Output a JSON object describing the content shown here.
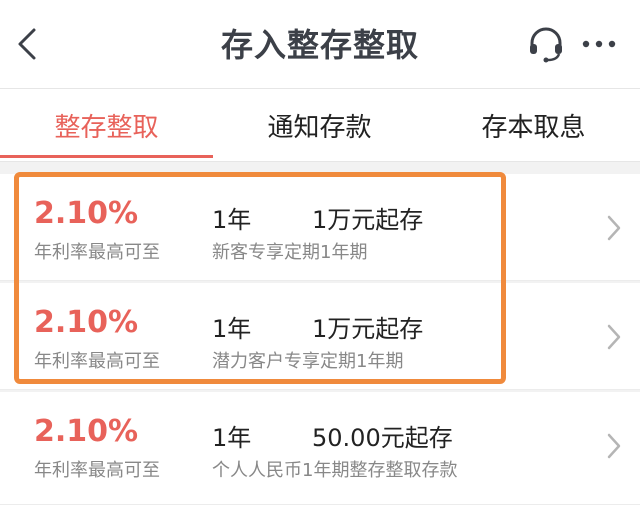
{
  "header": {
    "title": "存入整存整取"
  },
  "tabs": [
    {
      "label": "整存整取",
      "active": true
    },
    {
      "label": "通知存款",
      "active": false
    },
    {
      "label": "存本取息",
      "active": false
    }
  ],
  "products": [
    {
      "rate": "2.10%",
      "rate_label": "年利率最高可至",
      "term": "1年",
      "min_amount": "1万元起存",
      "desc": "新客专享定期1年期"
    },
    {
      "rate": "2.10%",
      "rate_label": "年利率最高可至",
      "term": "1年",
      "min_amount": "1万元起存",
      "desc": "潜力客户专享定期1年期"
    },
    {
      "rate": "2.10%",
      "rate_label": "年利率最高可至",
      "term": "1年",
      "min_amount": "50.00元起存",
      "desc": "个人人民币1年期整存整取存款"
    }
  ],
  "colors": {
    "accent": "#e8625a",
    "highlight": "#f08a3c",
    "text": "#222222",
    "muted": "#888888"
  },
  "icons": {
    "back": "chevron-left-icon",
    "support": "headset-icon",
    "more": "more-dots-icon",
    "row": "chevron-right-icon"
  }
}
